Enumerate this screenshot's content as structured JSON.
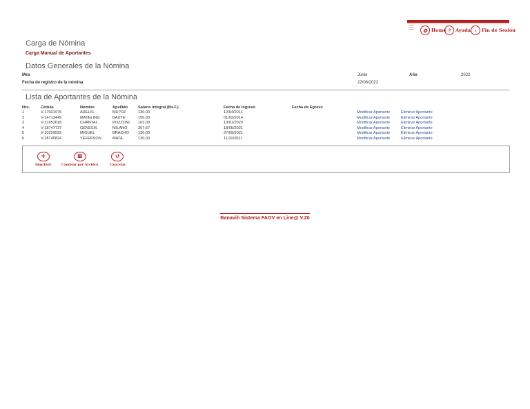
{
  "nav": {
    "items": [
      {
        "icon": "home-icon",
        "glyph": "✪",
        "label": "Home"
      },
      {
        "icon": "help-icon",
        "glyph": "?",
        "label": "Ayuda"
      },
      {
        "icon": "logout-icon",
        "glyph": "›",
        "label": "Fin de Sesión"
      }
    ]
  },
  "page": {
    "title": "Carga de Nómina",
    "subtitle": "Carga Manual de Aportantes",
    "section_general": "Datos Generales de la Nómina",
    "section_list": "Lista de Aportantes de la Nómina"
  },
  "general": {
    "mes_label": "Mes",
    "mes_value": "Junio",
    "anio_label": "Año",
    "anio_value": "2022",
    "fecha_label": "Fecha de registro de la nómina",
    "fecha_value": "22/06/2022"
  },
  "table": {
    "headers": [
      "Nro.",
      "Cédula",
      "Nombre",
      "Apellido",
      "Salario Integral (Bs.F.)",
      "Fecha de Ingreso",
      "Fecha de Egreso"
    ],
    "action_modify": "Modificar Aportante",
    "action_delete": "Eliminar Aportante",
    "rows": [
      {
        "nro": "1",
        "cedula": "V-17031976",
        "nombre": "ARELIS",
        "apellido": "MU?OZ",
        "salario": "130,00",
        "ingreso": "12/04/2011",
        "egreso": ""
      },
      {
        "nro": "2",
        "cedula": "V-14713449",
        "nombre": "MAYELING",
        "apellido": "BAUTE",
        "salario": "150,00",
        "ingreso": "01/02/2014",
        "egreso": ""
      },
      {
        "nro": "3",
        "cedula": "V-21653618",
        "nombre": "CHANTAL",
        "apellido": "POZZONI",
        "salario": "162,00",
        "ingreso": "13/01/2020",
        "egreso": ""
      },
      {
        "nro": "4",
        "cedula": "V-18747737",
        "nombre": "GENESIS",
        "apellido": "MILANO",
        "salario": "307,67",
        "ingreso": "18/05/2021",
        "egreso": ""
      },
      {
        "nro": "5",
        "cedula": "V-10229593",
        "nombre": "MIGUEL",
        "apellido": "BRACHO",
        "salario": "130,00",
        "ingreso": "27/09/2021",
        "egreso": ""
      },
      {
        "nro": "6",
        "cedula": "V-18745824",
        "nombre": "YEFERSON",
        "apellido": "MATA",
        "salario": "130,00",
        "ingreso": "11/10/2021",
        "egreso": ""
      }
    ]
  },
  "actions": [
    {
      "icon": "print-icon",
      "glyph": "+",
      "label": "Imprimir"
    },
    {
      "icon": "upload-file-icon",
      "glyph": "⊞",
      "label": "Cambiar por Archivo"
    },
    {
      "icon": "cancel-icon",
      "glyph": "↺",
      "label": "Cancelar"
    }
  ],
  "footer": "Banavih Sistema FAOV en Line@ V.20"
}
